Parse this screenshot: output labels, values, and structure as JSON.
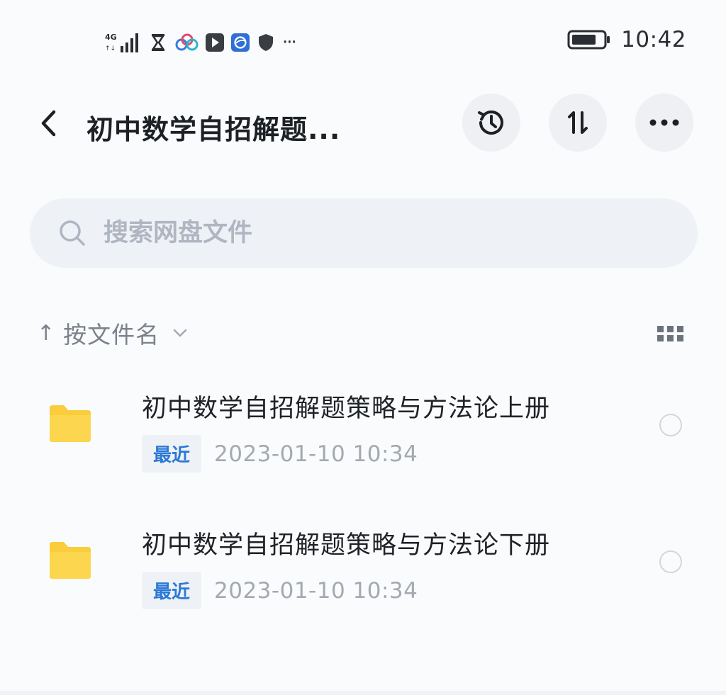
{
  "status_bar": {
    "network": "4G",
    "time": "10:42",
    "icons": [
      "signal-icon",
      "hourglass-icon",
      "cloud-app-icon",
      "video-app-icon",
      "browser-app-icon",
      "shield-icon",
      "more-notifications-icon"
    ],
    "more_dots": "···"
  },
  "header": {
    "title": "初中数学自招解题...",
    "actions": [
      "history-icon",
      "sort-order-icon",
      "more-icon"
    ]
  },
  "search": {
    "placeholder": "搜索网盘文件"
  },
  "sort": {
    "label": "按文件名",
    "direction_glyph": "↑"
  },
  "files": [
    {
      "name": "初中数学自招解题策略与方法论上册",
      "badge": "最近",
      "datetime": "2023-01-10  10:34"
    },
    {
      "name": "初中数学自招解题策略与方法论下册",
      "badge": "最近",
      "datetime": "2023-01-10  10:34"
    }
  ],
  "colors": {
    "folder": "#f9cd3c",
    "badge_text": "#2b79d6",
    "button_bg": "#eef0f3",
    "search_bg": "#eef1f6"
  }
}
